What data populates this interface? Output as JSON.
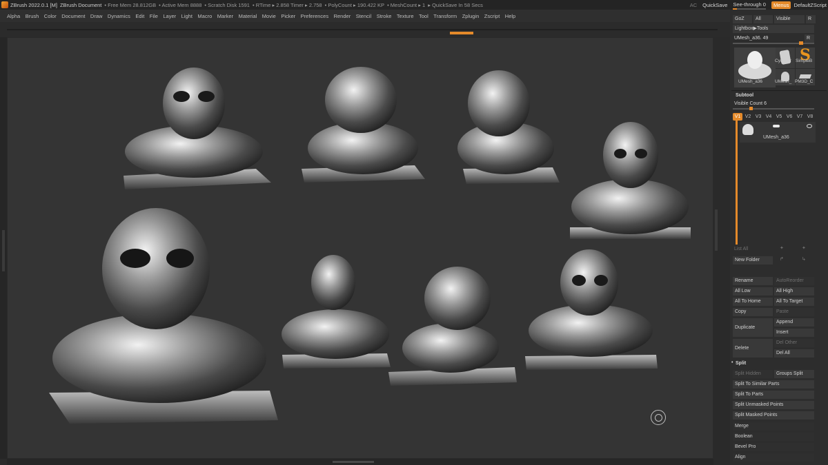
{
  "titlebar": {
    "app": "ZBrush 2022.0.1 [M]",
    "doc": "ZBrush Document",
    "free_mem": "• Free Mem 28.812GB",
    "active_mem": "• Active Mem 8888",
    "scratch": "• Scratch Disk 1591",
    "rtime": "• RTime ▸ 2.858 Timer ▸ 2.758",
    "polycount": "• PolyCount ▸ 190.422 KP",
    "meshcount": "• MeshCount ▸ 1",
    "quicksave_in": "▸ QuickSave In 58 Secs",
    "ac": "AC",
    "quicksave": "QuickSave",
    "seethrough": "See-through  0",
    "menus": "Menus",
    "script": "DefaultZScript"
  },
  "menubar": [
    "Alpha",
    "Brush",
    "Color",
    "Document",
    "Draw",
    "Dynamics",
    "Edit",
    "File",
    "Layer",
    "Light",
    "Macro",
    "Marker",
    "Material",
    "Movie",
    "Picker",
    "Preferences",
    "Render",
    "Stencil",
    "Stroke",
    "Texture",
    "Tool",
    "Transform",
    "Zplugin",
    "Zscript",
    "Help"
  ],
  "tool": {
    "goz": "GoZ",
    "all": "All",
    "visible": "Visible",
    "r": "R",
    "lightbox": "Lightbox▶Tools",
    "mesh_name": "UMesh_a36. 49",
    "r2": "R",
    "thumbs": [
      "UMesh_a36",
      "Cylinder",
      "SimpleB",
      "UMesh_",
      "PM3D_C"
    ]
  },
  "subtool": {
    "title": "Subtool",
    "visible_count": "Visible Count 6",
    "tabs": [
      "V1",
      "V2",
      "V3",
      "V4",
      "V5",
      "V6",
      "V7",
      "V8"
    ],
    "item_name": "UMesh_a36",
    "list_all": "List All",
    "new_folder": "New Folder",
    "rename": "Rename",
    "auto_reorder": "AutoReorder",
    "all_low": "All Low",
    "all_high": "All High",
    "all_to_home": "All To Home",
    "all_to_target": "All To Target",
    "copy": "Copy",
    "paste": "Paste",
    "duplicate": "Duplicate",
    "append": "Append",
    "insert": "Insert",
    "delete": "Delete",
    "del_other": "Del Other",
    "del_all": "Del All",
    "split": "Split",
    "split_hidden": "Split Hidden",
    "groups_split": "Groups Split",
    "split_similar": "Split To Similar Parts",
    "split_parts": "Split To Parts",
    "split_unmasked": "Split Unmasked Points",
    "split_masked": "Split Masked Points",
    "merge": "Merge",
    "boolean": "Boolean",
    "bevel_pro": "Bevel Pro",
    "align": "Align"
  },
  "colors": {
    "accent": "#e58a2a",
    "bg": "#2b2b2b",
    "canvas": "#343434"
  }
}
